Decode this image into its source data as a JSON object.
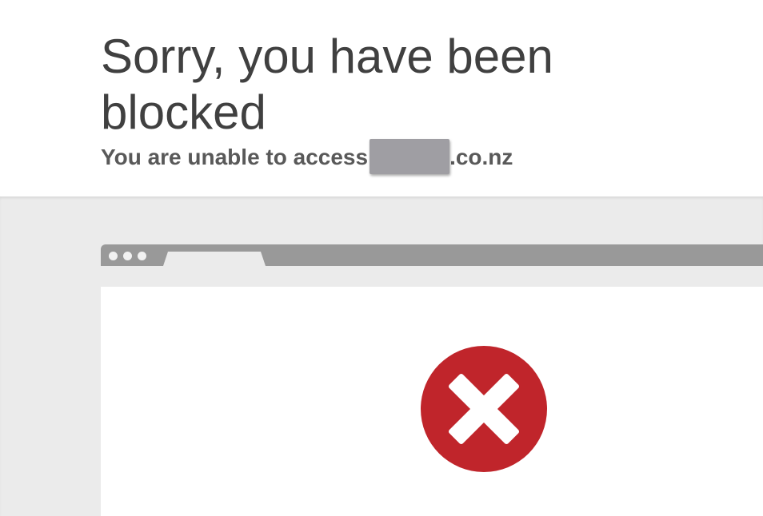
{
  "header": {
    "title": "Sorry, you have been blocked",
    "subtitle_prefix": "You are unable to access",
    "subtitle_domain_suffix": ".co.nz"
  },
  "icons": {
    "error": "error-x-circle-icon",
    "error_color": "#c0252b"
  },
  "colors": {
    "title_text": "#404040",
    "browser_bar": "#999999",
    "page_background": "#ebebeb"
  }
}
